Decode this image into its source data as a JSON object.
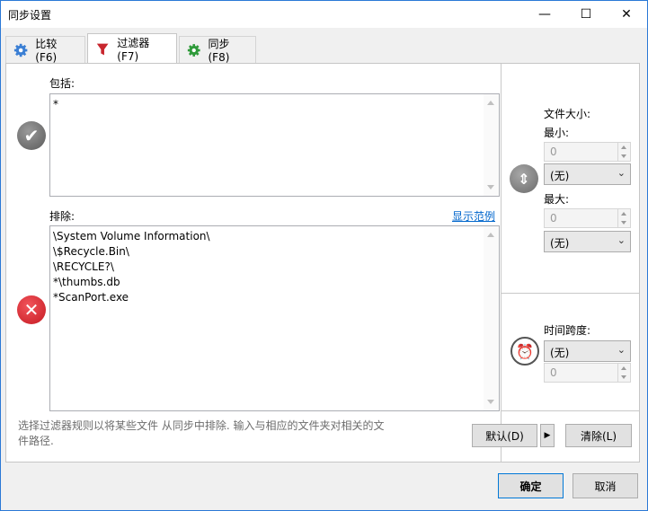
{
  "window": {
    "title": "同步设置",
    "minimize_glyph": "—",
    "maximize_glyph": "☐",
    "close_glyph": "✕"
  },
  "tabs": [
    {
      "label": "比较 (F6)",
      "icon": "gear-blue-icon"
    },
    {
      "label": "过滤器 (F7)",
      "icon": "funnel-icon",
      "active": true
    },
    {
      "label": "同步 (F8)",
      "icon": "gear-green-icon"
    }
  ],
  "include": {
    "label": "包括:",
    "lines": [
      "*"
    ]
  },
  "exclude": {
    "label": "排除:",
    "example_link": "显示范例",
    "lines": [
      "\\System Volume Information\\",
      "\\$Recycle.Bin\\",
      "\\RECYCLE?\\",
      "*\\thumbs.db",
      "*ScanPort.exe"
    ]
  },
  "file_size": {
    "label": "文件大小:",
    "min_label": "最小:",
    "min_value": "0",
    "min_unit": "(无)",
    "max_label": "最大:",
    "max_value": "0",
    "max_unit": "(无)"
  },
  "time_span": {
    "label": "时间跨度:",
    "selection": "(无)",
    "value": "0"
  },
  "description": "选择过滤器规则以将某些文件 从同步中排除. 输入与相应的文件夹对相关的文件路径.",
  "buttons": {
    "default": "默认(D)",
    "dropdown_glyph": "▶",
    "clear": "清除(L)",
    "ok": "确定",
    "cancel": "取消"
  },
  "colors": {
    "accent": "#2b79d6",
    "include_icon": "#6e6e6e",
    "exclude_icon": "#d9282f",
    "link": "#0066cc"
  }
}
